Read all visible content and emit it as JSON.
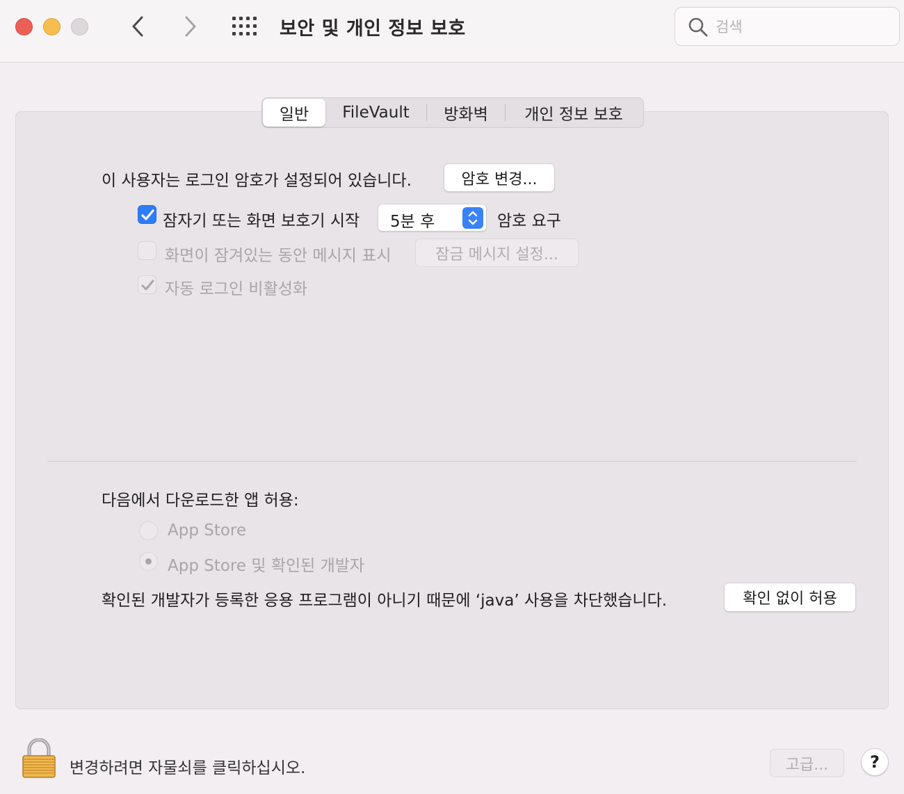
{
  "window": {
    "title": "보안 및 개인 정보 보호",
    "search_placeholder": "검색"
  },
  "tabs": [
    {
      "label": "일반",
      "active": true
    },
    {
      "label": "FileVault",
      "active": false
    },
    {
      "label": "방화벽",
      "active": false
    },
    {
      "label": "개인 정보 보호",
      "active": false
    }
  ],
  "general": {
    "login_password_text": "이 사용자는 로그인 암호가 설정되어 있습니다.",
    "change_password_button": "암호 변경...",
    "require_password": {
      "checked": true,
      "label_before": "잠자기 또는 화면 보호기 시작",
      "selected_delay": "5분 후",
      "label_after": "암호 요구"
    },
    "show_message": {
      "checked": false,
      "enabled": false,
      "label": "화면이 잠겨있는 동안 메시지 표시",
      "button": "잠금 메시지 설정..."
    },
    "disable_auto_login": {
      "checked": true,
      "enabled": false,
      "label": "자동 로그인 비활성화"
    }
  },
  "downloads": {
    "heading": "다음에서 다운로드한 앱 허용:",
    "options": [
      {
        "label": "App Store",
        "selected": false
      },
      {
        "label": "App Store 및 확인된 개발자",
        "selected": true
      }
    ],
    "blocked_message": "확인된 개발자가 등록한 응용 프로그램이 아니기 때문에 ‘java’ 사용을 차단했습니다.",
    "allow_button": "확인 없이 허용"
  },
  "footer": {
    "lock_text": "변경하려면 자물쇠를 클릭하십시오.",
    "advanced_button": "고급...",
    "help_button": "?"
  },
  "colors": {
    "accent": "#2e7cf6",
    "close": "#ec5f57",
    "minimize": "#f5be4f",
    "zoom_inactive": "#dcd8db"
  }
}
